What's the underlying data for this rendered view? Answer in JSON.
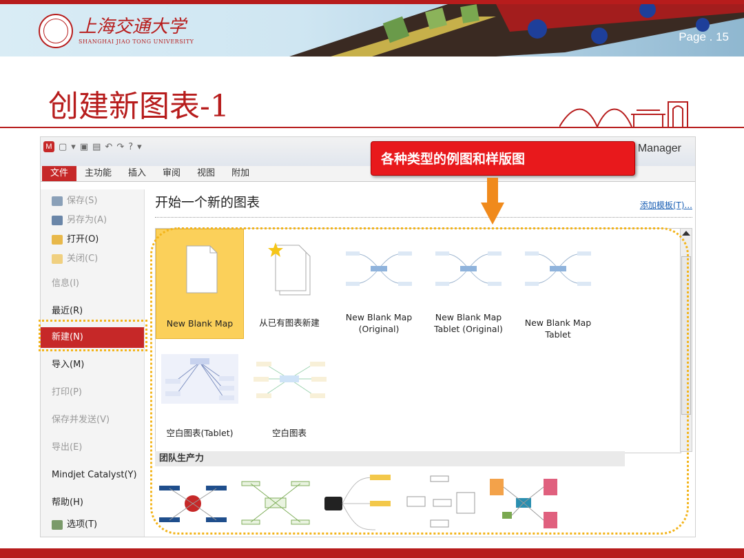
{
  "header": {
    "university_cn": "上海交通大学",
    "university_en": "SHANGHAI JIAO TONG UNIVERSITY",
    "page_number": "Page . 15"
  },
  "slide": {
    "title": "创建新图表-1"
  },
  "app": {
    "window_title": "Manager",
    "ribbon_tabs": [
      "文件",
      "主功能",
      "插入",
      "审阅",
      "视图",
      "附加"
    ],
    "sidebar": [
      {
        "label": "保存(S)",
        "icon": "save-icon"
      },
      {
        "label": "另存为(A)",
        "icon": "save-as-icon"
      },
      {
        "label": "打开(O)",
        "icon": "open-folder-icon"
      },
      {
        "label": "关闭(C)",
        "icon": "close-folder-icon"
      },
      {
        "label": "信息(I)"
      },
      {
        "label": "最近(R)"
      },
      {
        "label": "新建(N)"
      },
      {
        "label": "导入(M)"
      },
      {
        "label": "打印(P)"
      },
      {
        "label": "保存并发送(V)"
      },
      {
        "label": "导出(E)"
      },
      {
        "label": "Mindjet Catalyst(Y)"
      },
      {
        "label": "帮助(H)"
      },
      {
        "label": "选项(T)",
        "icon": "options-icon"
      }
    ],
    "main_heading": "开始一个新的图表",
    "add_template_link": "添加模板(T)...",
    "gallery": [
      {
        "label": "New Blank Map"
      },
      {
        "label": "从已有图表新建"
      },
      {
        "label": "New Blank Map (Original)"
      },
      {
        "label": "New Blank Map Tablet (Original)"
      },
      {
        "label": "New Blank Map Tablet"
      },
      {
        "label": "空白图表(Tablet)"
      },
      {
        "label": "空白图表"
      }
    ],
    "section_title": "团队生产力"
  },
  "callout": {
    "text": "各种类型的例图和样版图"
  },
  "colors": {
    "brand_red": "#b71c1c",
    "selection": "#fbd05a",
    "highlight_dots": "#f3b41a",
    "callout_red": "#e8191c",
    "arrow_orange": "#f08a1c"
  }
}
